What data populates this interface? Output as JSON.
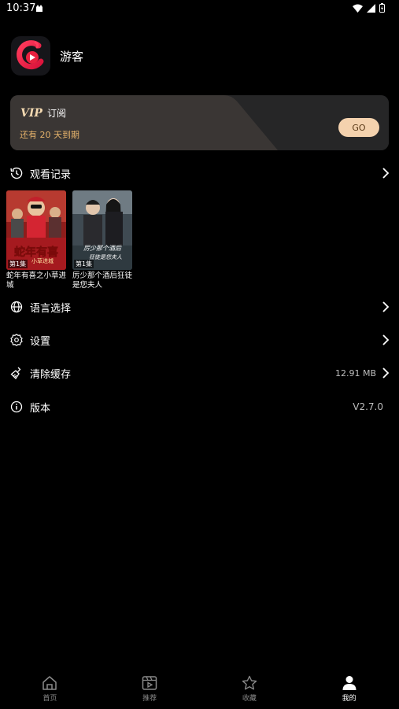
{
  "status_bar": {
    "time": "10:37"
  },
  "profile": {
    "username": "游客"
  },
  "vip": {
    "badge": "VIP",
    "label": "订阅",
    "expiry": "还有 20 天到期",
    "go_label": "GO",
    "accent_color": "#e6b36b",
    "button_color": "#f4d2ae"
  },
  "history": {
    "label": "观看记录",
    "items": [
      {
        "title": "蛇年有喜之小草进城",
        "episode": "第1集",
        "poster_text": "蛇年有喜",
        "poster_subtext": "小草进城"
      },
      {
        "title": "厉少那个酒后狂徒是您夫人",
        "episode": "第1集",
        "poster_text": "厉少那个酒后",
        "poster_subtext": "狂徒是您夫人"
      }
    ]
  },
  "menu": {
    "language": {
      "label": "语言选择"
    },
    "settings": {
      "label": "设置"
    },
    "cache": {
      "label": "清除缓存",
      "value": "12.91 MB"
    },
    "version": {
      "label": "版本",
      "value": "V2.7.0"
    }
  },
  "tabbar": {
    "items": [
      {
        "label": "首页",
        "icon": "home-icon",
        "active": false
      },
      {
        "label": "推荐",
        "icon": "video-icon",
        "active": false
      },
      {
        "label": "收藏",
        "icon": "star-icon",
        "active": false
      },
      {
        "label": "我的",
        "icon": "profile-icon",
        "active": true
      }
    ]
  }
}
